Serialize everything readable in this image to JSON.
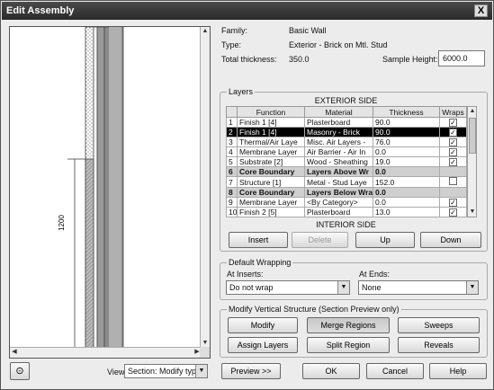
{
  "window": {
    "title": "Edit Assembly",
    "close": "X"
  },
  "info": {
    "family_label": "Family:",
    "family_value": "Basic Wall",
    "type_label": "Type:",
    "type_value": "Exterior - Brick on Mtl. Stud",
    "thickness_label": "Total thickness:",
    "thickness_value": "350.0",
    "sample_height_label": "Sample Height:",
    "sample_height_value": "6000.0"
  },
  "preview": {
    "dimension_label": "1200"
  },
  "layers": {
    "group_label": "Layers",
    "exterior_label": "EXTERIOR SIDE",
    "interior_label": "INTERIOR SIDE",
    "columns": [
      "",
      "Function",
      "Material",
      "Thickness",
      "Wraps"
    ],
    "rows": [
      {
        "num": "1",
        "function": "Finish 1 [4]",
        "material": "Plasterboard",
        "thickness": "90.0",
        "wraps": "✓"
      },
      {
        "num": "2",
        "function": "Finish 1 [4]",
        "material": "Masonry - Brick",
        "thickness": "90.0",
        "wraps": "✓"
      },
      {
        "num": "3",
        "function": "Thermal/Air Laye",
        "material": "Misc. Air Layers -",
        "thickness": "76.0",
        "wraps": "✓"
      },
      {
        "num": "4",
        "function": "Membrane Layer",
        "material": "Air Barrier - Air In",
        "thickness": "0.0",
        "wraps": "✓"
      },
      {
        "num": "5",
        "function": "Substrate [2]",
        "material": "Wood - Sheathing",
        "thickness": "19.0",
        "wraps": "✓"
      },
      {
        "num": "6",
        "function": "Core Boundary",
        "material": "Layers Above Wr",
        "thickness": "0.0",
        "wraps": ""
      },
      {
        "num": "7",
        "function": "Structure [1]",
        "material": "Metal - Stud Laye",
        "thickness": "152.0",
        "wraps": ""
      },
      {
        "num": "8",
        "function": "Core Boundary",
        "material": "Layers Below Wra",
        "thickness": "0.0",
        "wraps": ""
      },
      {
        "num": "9",
        "function": "Membrane Layer",
        "material": "<By Category>",
        "thickness": "0.0",
        "wraps": "✓"
      },
      {
        "num": "10",
        "function": "Finish 2 [5]",
        "material": "Plasterboard",
        "thickness": "13.0",
        "wraps": "✓"
      }
    ],
    "buttons": {
      "insert": "Insert",
      "delete": "Delete",
      "up": "Up",
      "down": "Down"
    }
  },
  "wrapping": {
    "group_label": "Default Wrapping",
    "at_inserts_label": "At Inserts:",
    "at_inserts_value": "Do not wrap",
    "at_ends_label": "At Ends:",
    "at_ends_value": "None"
  },
  "vertical": {
    "group_label": "Modify Vertical Structure (Section Preview only)",
    "modify": "Modify",
    "merge_regions": "Merge Regions",
    "sweeps": "Sweeps",
    "assign_layers": "Assign Layers",
    "split_region": "Split Region",
    "reveals": "Reveals"
  },
  "footer": {
    "view_label": "View:",
    "view_value": "Section: Modify type",
    "preview": "Preview >>",
    "ok": "OK",
    "cancel": "Cancel",
    "help": "Help"
  }
}
